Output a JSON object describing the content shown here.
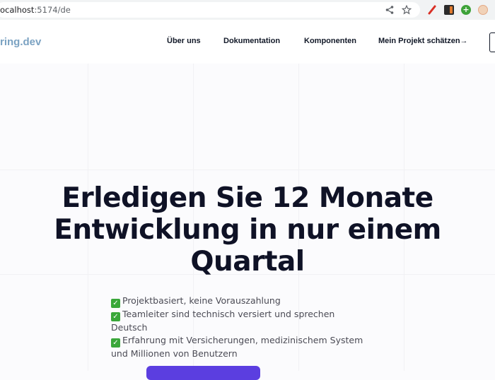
{
  "browser": {
    "url_prefix": "ocalhost",
    "url_rest": ":5174/de",
    "icons": [
      "share-icon",
      "star-icon",
      "pen-extension-icon",
      "box-extension-icon",
      "plus-extension-icon",
      "cookie-extension-icon"
    ]
  },
  "header": {
    "logo_text": "ring.dev",
    "nav": [
      {
        "label": "Über uns"
      },
      {
        "label": "Dokumentation"
      },
      {
        "label": "Komponenten"
      },
      {
        "label": "Mein Projekt schätzen→"
      }
    ]
  },
  "hero": {
    "title_lines": [
      "Erledigen Sie 12 Monate",
      "Entwicklung in nur einem",
      "Quartal"
    ],
    "features": [
      "Projektbasiert, keine Vorauszahlung",
      "Teamleiter sind technisch versiert und sprechen Deutsch",
      "Erfahrung mit Versicherungen, medizinischem System und Millionen von Benutzern"
    ]
  },
  "colors": {
    "brand_logo": "#7ba2c2",
    "cta": "#5b3ee0",
    "check": "#3aa73a",
    "title": "#0f1226"
  }
}
